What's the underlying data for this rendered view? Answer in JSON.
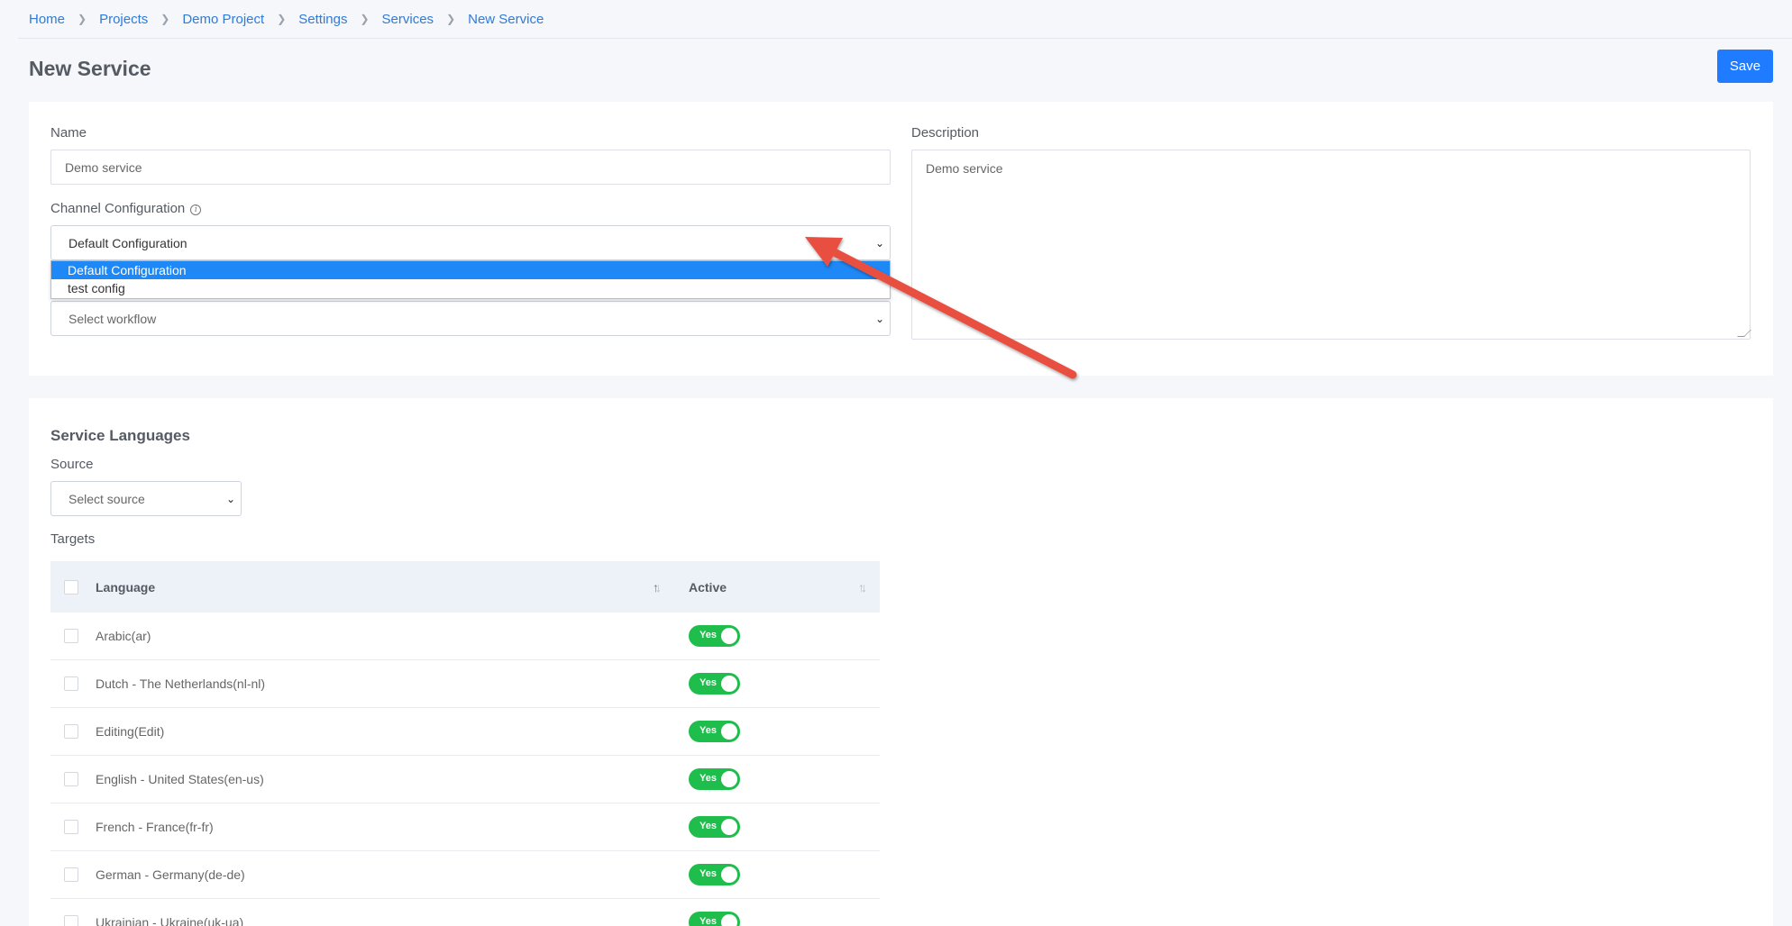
{
  "breadcrumb": [
    "Home",
    "Projects",
    "Demo Project",
    "Settings",
    "Services",
    "New Service"
  ],
  "page_title": "New Service",
  "save_label": "Save",
  "form": {
    "name_label": "Name",
    "name_value": "Demo service",
    "channel_label": "Channel Configuration",
    "channel_value": "Default Configuration",
    "channel_options": [
      "Default Configuration",
      "test config"
    ],
    "workflow_placeholder": "Select workflow",
    "description_label": "Description",
    "description_value": "Demo service"
  },
  "languages": {
    "title": "Service Languages",
    "source_label": "Source",
    "source_placeholder": "Select source",
    "targets_label": "Targets",
    "col_language": "Language",
    "col_active": "Active",
    "toggle_label": "Yes",
    "rows": [
      "Arabic(ar)",
      "Dutch - The Netherlands(nl-nl)",
      "Editing(Edit)",
      "English - United States(en-us)",
      "French - France(fr-fr)",
      "German - Germany(de-de)",
      "Ukrainian - Ukraine(uk-ua)"
    ]
  },
  "colors": {
    "accent": "#1f7bff",
    "toggle_on": "#1fbd4c",
    "annotation_arrow": "#e8503f"
  }
}
